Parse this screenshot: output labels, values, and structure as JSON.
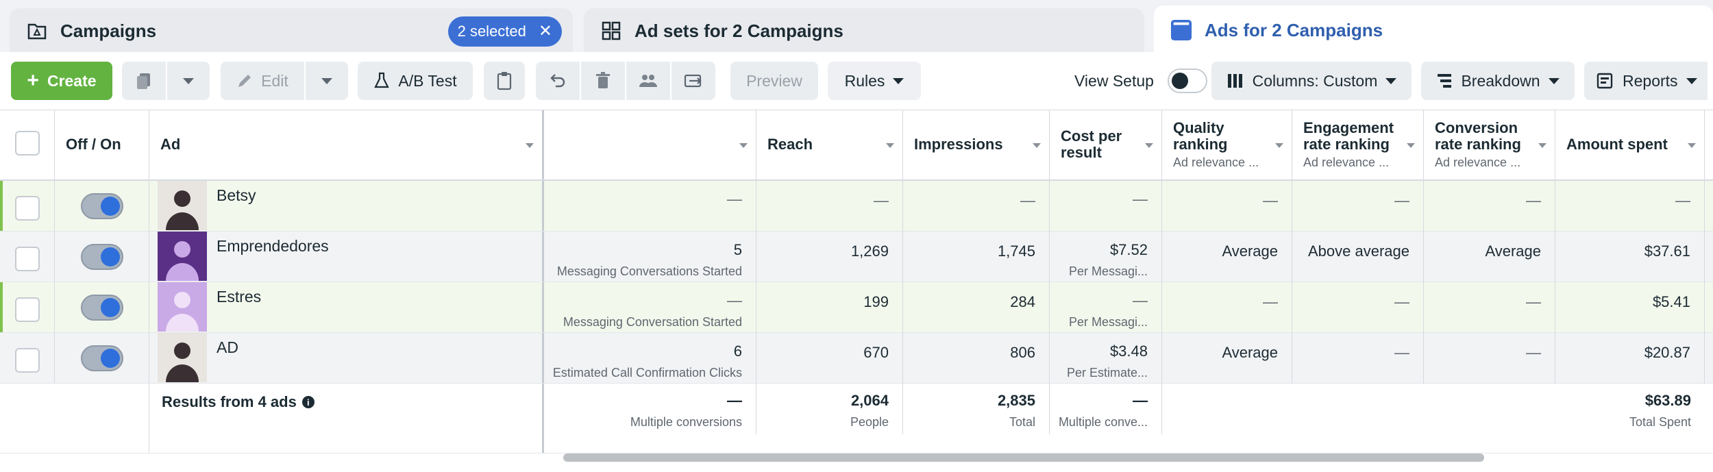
{
  "tabs": {
    "campaigns": {
      "label": "Campaigns",
      "selected_badge": "2 selected"
    },
    "adsets": {
      "label": "Ad sets for 2 Campaigns"
    },
    "ads": {
      "label": "Ads for 2 Campaigns"
    }
  },
  "toolbar": {
    "create": "Create",
    "edit": "Edit",
    "ab_test": "A/B Test",
    "preview": "Preview",
    "rules": "Rules",
    "view_setup": "View Setup",
    "columns": "Columns: Custom",
    "breakdown": "Breakdown",
    "reports": "Reports"
  },
  "columns": {
    "off_on": "Off / On",
    "ad": "Ad",
    "reach": "Reach",
    "impressions": "Impressions",
    "cost_per_result": "Cost per result",
    "quality_ranking": "Quality ranking",
    "quality_ranking_sub": "Ad relevance ...",
    "engagement_ranking": "Engagement rate ranking",
    "engagement_ranking_sub": "Ad relevance ...",
    "conversion_ranking": "Conversion rate ranking",
    "conversion_ranking_sub": "Ad relevance ...",
    "amount_spent": "Amount spent"
  },
  "rows": [
    {
      "name": "Betsy",
      "results": "—",
      "results_sub": "",
      "reach": "—",
      "impressions": "—",
      "cost": "—",
      "cost_sub": "",
      "quality": "—",
      "engagement": "—",
      "conversion": "—",
      "spent": "—"
    },
    {
      "name": "Emprendedores",
      "results": "5",
      "results_sub": "Messaging Conversations Started",
      "reach": "1,269",
      "impressions": "1,745",
      "cost": "$7.52",
      "cost_sub": "Per Messagi...",
      "quality": "Average",
      "engagement": "Above average",
      "conversion": "Average",
      "spent": "$37.61"
    },
    {
      "name": "Estres",
      "results": "—",
      "results_sub": "Messaging Conversation Started",
      "reach": "199",
      "impressions": "284",
      "cost": "—",
      "cost_sub": "Per Messagi...",
      "quality": "—",
      "engagement": "—",
      "conversion": "—",
      "spent": "$5.41"
    },
    {
      "name": "AD",
      "results": "6",
      "results_sub": "Estimated Call Confirmation Clicks",
      "reach": "670",
      "impressions": "806",
      "cost": "$3.48",
      "cost_sub": "Per Estimate...",
      "quality": "Average",
      "engagement": "—",
      "conversion": "—",
      "spent": "$20.87"
    }
  ],
  "totals": {
    "label": "Results from 4 ads",
    "results": "—",
    "results_sub": "Multiple conversions",
    "reach": "2,064",
    "reach_sub": "People",
    "impressions": "2,835",
    "impressions_sub": "Total",
    "cost": "—",
    "cost_sub": "Multiple conve...",
    "spent": "$63.89",
    "spent_sub": "Total Spent"
  },
  "colors": {
    "accent_blue": "#3b6fd4",
    "create_green": "#63b341",
    "active_row": "#f3f8ec"
  }
}
